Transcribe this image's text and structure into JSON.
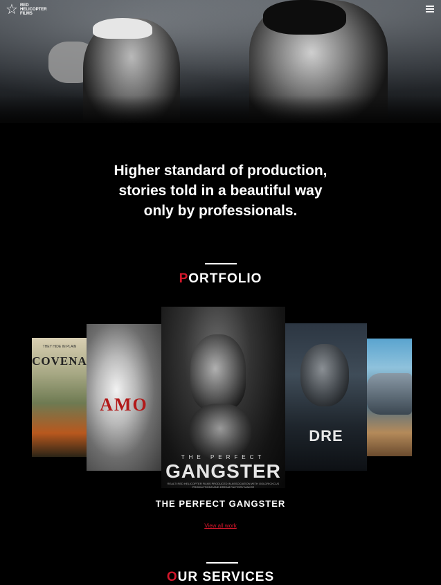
{
  "header": {
    "logo_text": "RED HELICOPTER FILMS",
    "menu_icon": "hamburger-icon"
  },
  "hero": {
    "tagline_line1": "Higher standard of production,",
    "tagline_line2": "stories told in a beautiful way",
    "tagline_line3": "only by professionals."
  },
  "portfolio": {
    "title_first": "P",
    "title_rest": "ORTFOLIO",
    "posters": [
      {
        "title": "COVENA",
        "small": "THEY HIDE IN PLAIN"
      },
      {
        "title": "AMO",
        "small": ""
      },
      {
        "pre": "THE PERFECT",
        "title": "GANGSTER",
        "credits": "REALTI RED HELICOPTER FILMS PRODUCED IN ASSOCIATION WITH OOLDRICKCUS PRODUCTIONS AND DREAM FACTORY MAKER"
      },
      {
        "title": "DRE",
        "small": ""
      },
      {
        "title": "",
        "small": ""
      }
    ],
    "featured_title": "THE PERFECT GANGSTER",
    "view_all": "View all work"
  },
  "services": {
    "title_first": "O",
    "title_rest": "UR SERVICES"
  },
  "colors": {
    "accent": "#d3172b",
    "background": "#000000",
    "text": "#ffffff"
  }
}
